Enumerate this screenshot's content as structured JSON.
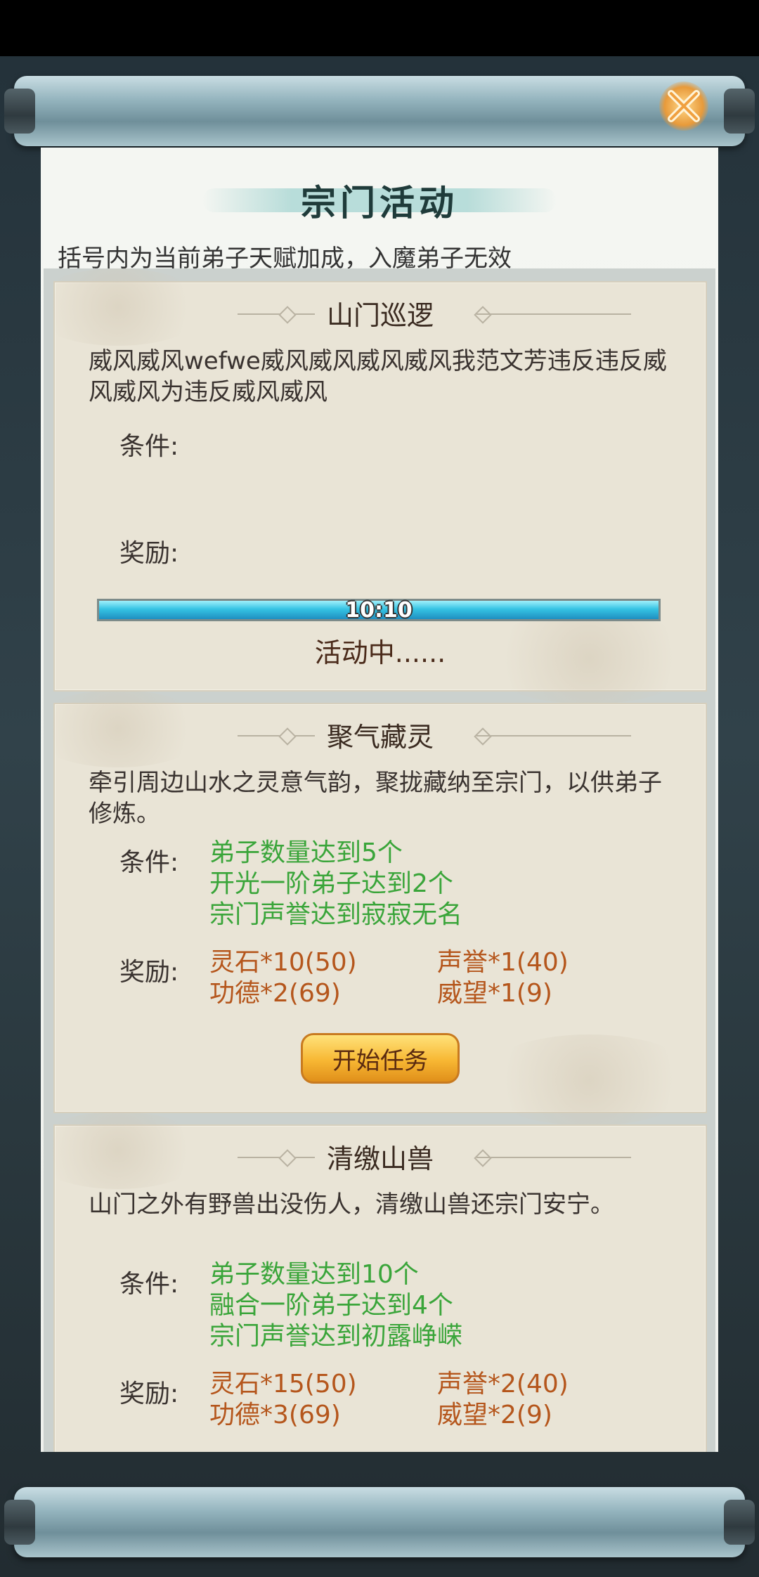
{
  "dialog": {
    "title": "宗门活动",
    "notice": "括号内为当前弟子天赋加成，入魔弟子无效"
  },
  "labels": {
    "conditions": "条件:",
    "rewards": "奖励:"
  },
  "activities": [
    {
      "name": "山门巡逻",
      "description": "威风威风wefwe威风威风威风威风我范文芳违反违反威风威风为违反威风威风",
      "conditions": [],
      "rewards": [],
      "progress_text": "10:10",
      "progress_fraction": 1.0,
      "status": "活动中......"
    },
    {
      "name": "聚气藏灵",
      "description": "牵引周边山水之灵意气韵，聚拢藏纳至宗门，以供弟子修炼。",
      "conditions": [
        "弟子数量达到5个",
        "开光一阶弟子达到2个",
        "宗门声誉达到寂寂无名"
      ],
      "rewards": [
        "灵石*10(50)",
        "声誉*1(40)",
        "功德*2(69)",
        "威望*1(9)"
      ],
      "button": "开始任务"
    },
    {
      "name": "清缴山兽",
      "description": "山门之外有野兽出没伤人，清缴山兽还宗门安宁。",
      "conditions": [
        "弟子数量达到10个",
        "融合一阶弟子达到4个",
        "宗门声誉达到初露峥嵘"
      ],
      "rewards": [
        "灵石*15(50)",
        "声誉*2(40)",
        "功德*3(69)",
        "威望*2(9)"
      ]
    }
  ],
  "colors": {
    "condition_text": "#3aa53a",
    "reward_text": "#b5561c",
    "progress_fill": "#35c3e3",
    "button_fill": "#f7b733"
  },
  "icons": {
    "close": "close-icon"
  }
}
